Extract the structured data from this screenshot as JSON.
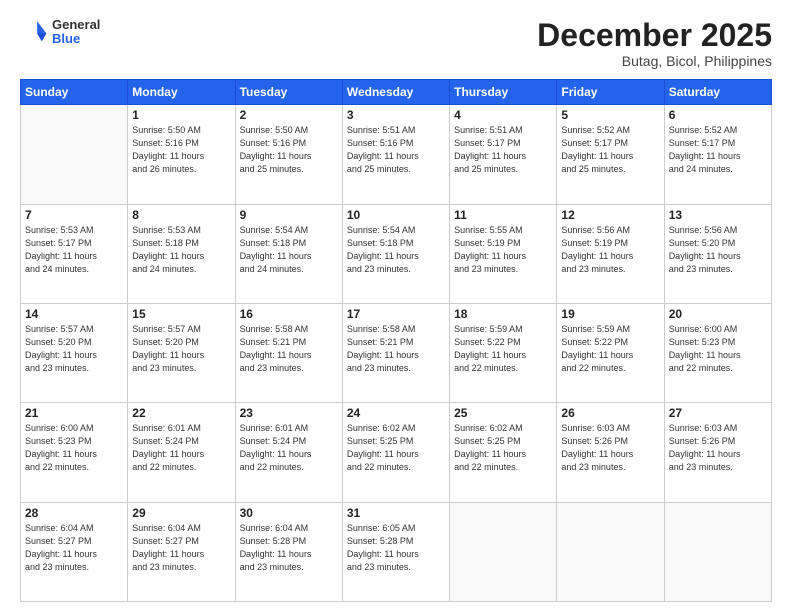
{
  "header": {
    "logo_general": "General",
    "logo_blue": "Blue",
    "month": "December 2025",
    "location": "Butag, Bicol, Philippines"
  },
  "weekdays": [
    "Sunday",
    "Monday",
    "Tuesday",
    "Wednesday",
    "Thursday",
    "Friday",
    "Saturday"
  ],
  "weeks": [
    [
      {
        "day": "",
        "info": ""
      },
      {
        "day": "1",
        "info": "Sunrise: 5:50 AM\nSunset: 5:16 PM\nDaylight: 11 hours\nand 26 minutes."
      },
      {
        "day": "2",
        "info": "Sunrise: 5:50 AM\nSunset: 5:16 PM\nDaylight: 11 hours\nand 25 minutes."
      },
      {
        "day": "3",
        "info": "Sunrise: 5:51 AM\nSunset: 5:16 PM\nDaylight: 11 hours\nand 25 minutes."
      },
      {
        "day": "4",
        "info": "Sunrise: 5:51 AM\nSunset: 5:17 PM\nDaylight: 11 hours\nand 25 minutes."
      },
      {
        "day": "5",
        "info": "Sunrise: 5:52 AM\nSunset: 5:17 PM\nDaylight: 11 hours\nand 25 minutes."
      },
      {
        "day": "6",
        "info": "Sunrise: 5:52 AM\nSunset: 5:17 PM\nDaylight: 11 hours\nand 24 minutes."
      }
    ],
    [
      {
        "day": "7",
        "info": "Sunrise: 5:53 AM\nSunset: 5:17 PM\nDaylight: 11 hours\nand 24 minutes."
      },
      {
        "day": "8",
        "info": "Sunrise: 5:53 AM\nSunset: 5:18 PM\nDaylight: 11 hours\nand 24 minutes."
      },
      {
        "day": "9",
        "info": "Sunrise: 5:54 AM\nSunset: 5:18 PM\nDaylight: 11 hours\nand 24 minutes."
      },
      {
        "day": "10",
        "info": "Sunrise: 5:54 AM\nSunset: 5:18 PM\nDaylight: 11 hours\nand 23 minutes."
      },
      {
        "day": "11",
        "info": "Sunrise: 5:55 AM\nSunset: 5:19 PM\nDaylight: 11 hours\nand 23 minutes."
      },
      {
        "day": "12",
        "info": "Sunrise: 5:56 AM\nSunset: 5:19 PM\nDaylight: 11 hours\nand 23 minutes."
      },
      {
        "day": "13",
        "info": "Sunrise: 5:56 AM\nSunset: 5:20 PM\nDaylight: 11 hours\nand 23 minutes."
      }
    ],
    [
      {
        "day": "14",
        "info": "Sunrise: 5:57 AM\nSunset: 5:20 PM\nDaylight: 11 hours\nand 23 minutes."
      },
      {
        "day": "15",
        "info": "Sunrise: 5:57 AM\nSunset: 5:20 PM\nDaylight: 11 hours\nand 23 minutes."
      },
      {
        "day": "16",
        "info": "Sunrise: 5:58 AM\nSunset: 5:21 PM\nDaylight: 11 hours\nand 23 minutes."
      },
      {
        "day": "17",
        "info": "Sunrise: 5:58 AM\nSunset: 5:21 PM\nDaylight: 11 hours\nand 23 minutes."
      },
      {
        "day": "18",
        "info": "Sunrise: 5:59 AM\nSunset: 5:22 PM\nDaylight: 11 hours\nand 22 minutes."
      },
      {
        "day": "19",
        "info": "Sunrise: 5:59 AM\nSunset: 5:22 PM\nDaylight: 11 hours\nand 22 minutes."
      },
      {
        "day": "20",
        "info": "Sunrise: 6:00 AM\nSunset: 5:23 PM\nDaylight: 11 hours\nand 22 minutes."
      }
    ],
    [
      {
        "day": "21",
        "info": "Sunrise: 6:00 AM\nSunset: 5:23 PM\nDaylight: 11 hours\nand 22 minutes."
      },
      {
        "day": "22",
        "info": "Sunrise: 6:01 AM\nSunset: 5:24 PM\nDaylight: 11 hours\nand 22 minutes."
      },
      {
        "day": "23",
        "info": "Sunrise: 6:01 AM\nSunset: 5:24 PM\nDaylight: 11 hours\nand 22 minutes."
      },
      {
        "day": "24",
        "info": "Sunrise: 6:02 AM\nSunset: 5:25 PM\nDaylight: 11 hours\nand 22 minutes."
      },
      {
        "day": "25",
        "info": "Sunrise: 6:02 AM\nSunset: 5:25 PM\nDaylight: 11 hours\nand 22 minutes."
      },
      {
        "day": "26",
        "info": "Sunrise: 6:03 AM\nSunset: 5:26 PM\nDaylight: 11 hours\nand 23 minutes."
      },
      {
        "day": "27",
        "info": "Sunrise: 6:03 AM\nSunset: 5:26 PM\nDaylight: 11 hours\nand 23 minutes."
      }
    ],
    [
      {
        "day": "28",
        "info": "Sunrise: 6:04 AM\nSunset: 5:27 PM\nDaylight: 11 hours\nand 23 minutes."
      },
      {
        "day": "29",
        "info": "Sunrise: 6:04 AM\nSunset: 5:27 PM\nDaylight: 11 hours\nand 23 minutes."
      },
      {
        "day": "30",
        "info": "Sunrise: 6:04 AM\nSunset: 5:28 PM\nDaylight: 11 hours\nand 23 minutes."
      },
      {
        "day": "31",
        "info": "Sunrise: 6:05 AM\nSunset: 5:28 PM\nDaylight: 11 hours\nand 23 minutes."
      },
      {
        "day": "",
        "info": ""
      },
      {
        "day": "",
        "info": ""
      },
      {
        "day": "",
        "info": ""
      }
    ]
  ]
}
